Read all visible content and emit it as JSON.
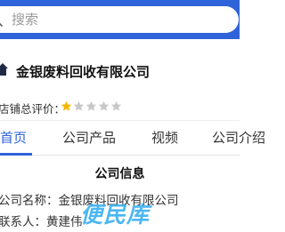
{
  "search": {
    "placeholder": "搜索",
    "icon": "search-icon"
  },
  "shop": {
    "title": "金银废料回收有限公司",
    "icon": "home-icon"
  },
  "rating": {
    "label": "店铺总评价：",
    "score": 1,
    "max": 5,
    "filled_color": "#f5b800",
    "empty_color": "#c8c8c8"
  },
  "tabs": [
    {
      "label": "首页",
      "active": true
    },
    {
      "label": "公司产品",
      "active": false
    },
    {
      "label": "视频",
      "active": false
    },
    {
      "label": "公司介绍",
      "active": false
    }
  ],
  "company_info": {
    "title": "公司信息",
    "name_line": "公司名称：金银废料回收有限公司",
    "contact_line": "联系人：黄建伟"
  },
  "watermark": "便民库",
  "colors": {
    "accent": "#2f63d9"
  }
}
